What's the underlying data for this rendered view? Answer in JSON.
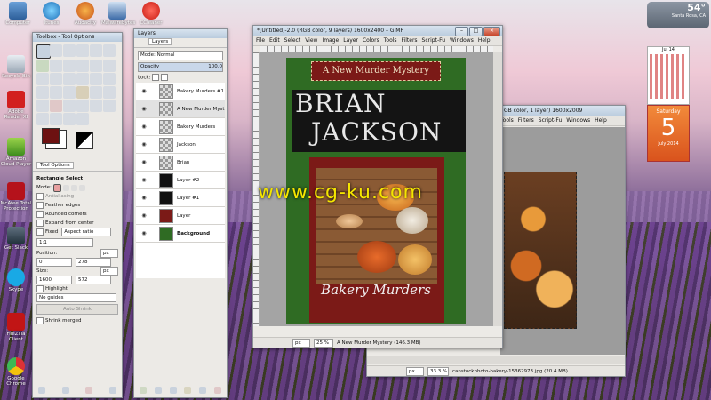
{
  "desktop": {
    "icons": [
      {
        "label": "Computer"
      },
      {
        "label": "Itunes"
      },
      {
        "label": "Audacity"
      },
      {
        "label": "Malwarebytes"
      },
      {
        "label": "CCleaner"
      },
      {
        "label": "Recycle Bin"
      },
      {
        "label": "Adobe Reader XI"
      },
      {
        "label": "Amazon Cloud Player"
      },
      {
        "label": "McAfee Total Protection"
      },
      {
        "label": "Get Slack"
      },
      {
        "label": "Skype"
      },
      {
        "label": "FileZilla Client"
      },
      {
        "label": "Google Chrome"
      }
    ]
  },
  "weather": {
    "temp": "54°",
    "location": "Santa Rosa, CA"
  },
  "calendar": {
    "month": "Jul 14",
    "weekday": "Saturday",
    "day": "5",
    "month_year": "July 2014"
  },
  "toolbox": {
    "title": "Toolbox - Tool Options",
    "tab_label": "Tool Options",
    "tool_name": "Rectangle Select",
    "mode_label": "Mode:",
    "antialiasing": "Antialiasing",
    "feather": "Feather edges",
    "rounded": "Rounded corners",
    "expand": "Expand from center",
    "fixed_label": "Fixed",
    "fixed_value": "Aspect ratio",
    "ratio": "1:1",
    "position_label": "Position:",
    "pos_unit": "px",
    "pos_x": "0",
    "pos_y": "278",
    "size_label": "Size:",
    "size_unit": "px",
    "size_w": "1600",
    "size_h": "572",
    "highlight": "Highlight",
    "guides": "No guides",
    "auto_shrink": "Auto Shrink",
    "shrink_merged": "Shrink merged"
  },
  "layers": {
    "title": "Layers",
    "tab_label": "Layers",
    "mode_label": "Mode: Normal",
    "opacity_label": "Opacity",
    "opacity_value": "100.0",
    "lock_label": "Lock:",
    "items": [
      {
        "name": "Bakery Murders #1"
      },
      {
        "name": "A New Murder Myst"
      },
      {
        "name": "Bakery Murders"
      },
      {
        "name": "Jackson"
      },
      {
        "name": "Brian"
      },
      {
        "name": "Layer #2"
      },
      {
        "name": "Layer #1"
      },
      {
        "name": "Layer"
      },
      {
        "name": "Background"
      }
    ]
  },
  "main_window": {
    "title": "*[Untitled]-2.0 (RGB color, 9 layers) 1600x2400 – GIMP",
    "menu": [
      "File",
      "Edit",
      "Select",
      "View",
      "Image",
      "Layer",
      "Colors",
      "Tools",
      "Filters",
      "Script-Fu",
      "Windows",
      "Help"
    ],
    "unit": "px",
    "zoom": "25 %",
    "status": "A New Murder Mystery (146.3 MB)",
    "cover": {
      "tagline": "A New Murder Mystery",
      "first_name": "BRIAN",
      "last_name": "JACKSON",
      "title": "Bakery Murders"
    }
  },
  "second_window": {
    "title": "GB color, 1 layer) 1600x2009",
    "menu": [
      "Tools",
      "Filters",
      "Script-Fu",
      "Windows",
      "Help"
    ],
    "unit": "px",
    "zoom": "33.3 %",
    "status": "canstockphoto-bakery-15362973.jpg (20.4 MB)"
  },
  "watermark": "www.cg-ku.com",
  "colors": {
    "cover_green": "#2f6b23",
    "cover_red": "#7b1a17",
    "cover_black": "#141414",
    "watermark": "#f5e600"
  }
}
